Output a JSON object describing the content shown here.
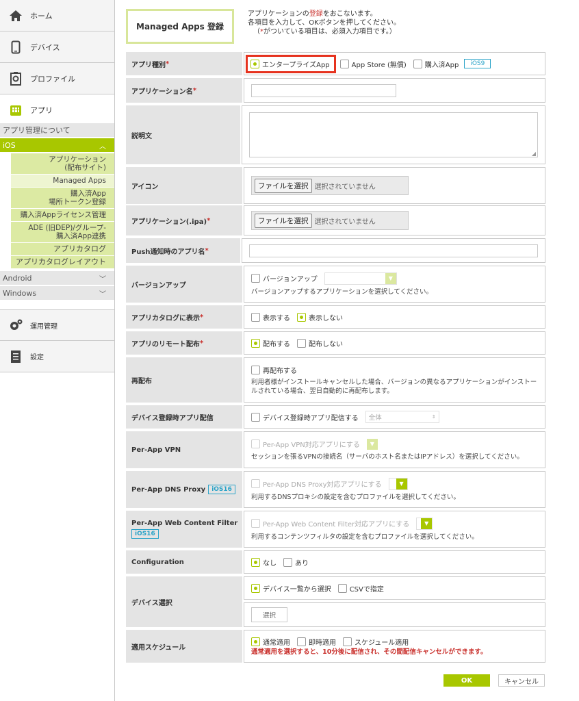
{
  "sidebar": {
    "nav": [
      {
        "label": "ホーム",
        "icon": "home-icon"
      },
      {
        "label": "デバイス",
        "icon": "device-icon"
      },
      {
        "label": "プロファイル",
        "icon": "profile-icon"
      },
      {
        "label": "アプリ",
        "icon": "app-icon"
      }
    ],
    "about": "アプリ管理について",
    "ios": "iOS",
    "ios_items": [
      {
        "label": "アプリケーション\n(配布サイト)"
      },
      {
        "label": "Managed Apps"
      },
      {
        "label": "購入済App\n場所トークン登録"
      },
      {
        "label": "購入済Appライセンス管理"
      },
      {
        "label": "ADE (旧DEP)/グループ-\n購入済App連携"
      },
      {
        "label": "アプリカタログ"
      },
      {
        "label": "アプリカタログレイアウト"
      }
    ],
    "android": "Android",
    "windows": "Windows",
    "ops": {
      "label": "運用管理",
      "icon": "gear-icon"
    },
    "settings": {
      "label": "設定",
      "icon": "document-icon"
    }
  },
  "header": {
    "title": "Managed Apps 登録",
    "intro_1a": "アプリケーションの",
    "intro_1b": "登録",
    "intro_1c": "をおこないます。",
    "intro_2": "各項目を入力して、OKボタンを押してください。",
    "intro_3a": "（",
    "intro_3b": "*",
    "intro_3c": "がついている項目は、必須入力項目です。）"
  },
  "form": {
    "app_type": {
      "label": "アプリ種別",
      "opt1": "エンタープライズApp",
      "opt2": "App Store (無償)",
      "opt3": "購入済App",
      "badge": "iOS9"
    },
    "app_name": {
      "label": "アプリケーション名"
    },
    "description": {
      "label": "説明文"
    },
    "icon": {
      "label": "アイコン",
      "button": "ファイルを選択",
      "status": "選択されていません"
    },
    "ipa": {
      "label": "アプリケーション(.ipa)",
      "button": "ファイルを選択",
      "status": "選択されていません"
    },
    "push_name": {
      "label": "Push通知時のアプリ名"
    },
    "version_up": {
      "label": "バージョンアップ",
      "checkbox": "バージョンアップ",
      "note": "バージョンアップするアプリケーションを選択してください。"
    },
    "catalog": {
      "label": "アプリカタログに表示",
      "opt1": "表示する",
      "opt2": "表示しない"
    },
    "remote": {
      "label": "アプリのリモート配布",
      "opt1": "配布する",
      "opt2": "配布しない"
    },
    "redistribute": {
      "label": "再配布",
      "checkbox": "再配布する",
      "note": "利用者様がインストールキャンセルした場合、バージョンの異なるアプリケーションがインストールされている場合、翌日自動的に再配布します。"
    },
    "device_reg": {
      "label": "デバイス登録時アプリ配信",
      "checkbox": "デバイス登録時アプリ配信する",
      "select": "全体"
    },
    "vpn": {
      "label": "Per-App VPN",
      "checkbox": "Per-App VPN対応アプリにする",
      "note": "セッションを張るVPNの接続名（サーバのホスト名またはIPアドレス）を選択してください。"
    },
    "dns": {
      "label": "Per-App DNS Proxy",
      "badge": "iOS16",
      "checkbox": "Per-App DNS Proxy対応アプリにする",
      "note": "利用するDNSプロキシの設定を含むプロファイルを選択してください。"
    },
    "wcf": {
      "label": "Per-App Web Content Filter",
      "badge": "iOS16",
      "checkbox": "Per-App Web Content Filter対応アプリにする",
      "note": "利用するコンテンツフィルタの設定を含むプロファイルを選択してください。"
    },
    "config": {
      "label": "Configuration",
      "opt1": "なし",
      "opt2": "あり"
    },
    "device_select": {
      "label": "デバイス選択",
      "opt1": "デバイス一覧から選択",
      "opt2": "CSVで指定",
      "button": "選択"
    },
    "schedule": {
      "label": "適用スケジュール",
      "opt1": "通常適用",
      "opt2": "即時適用",
      "opt3": "スケジュール適用",
      "note": "通常適用を選択すると、10分後に配信され、その間配信キャンセルができます。"
    }
  },
  "required_mark": "*",
  "actions": {
    "ok": "OK",
    "cancel": "キャンセル"
  }
}
